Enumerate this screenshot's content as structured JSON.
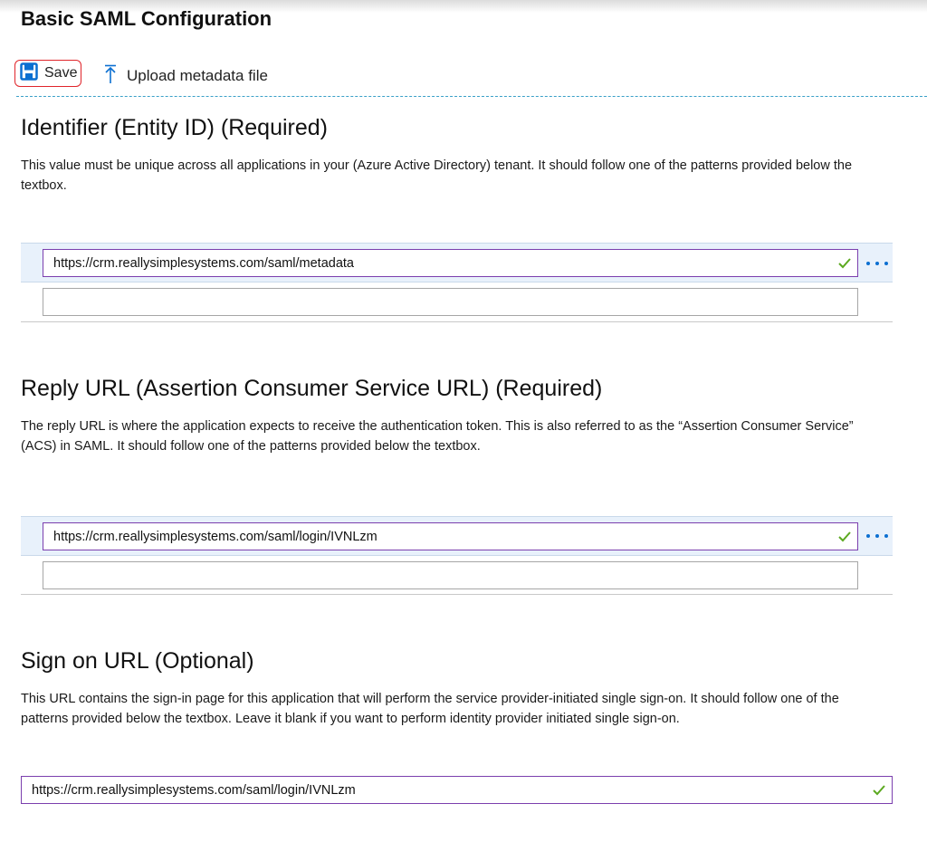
{
  "page": {
    "title": "Basic SAML Configuration"
  },
  "toolbar": {
    "save_label": "Save",
    "upload_label": "Upload metadata file"
  },
  "sections": [
    {
      "heading": "Identifier (Entity ID) (Required)",
      "description": "This value must be unique across all applications in your (Azure Active Directory) tenant. It should follow one of the patterns provided below the textbox.",
      "values": [
        "https://crm.reallysimplesystems.com/saml/metadata",
        ""
      ]
    },
    {
      "heading": "Reply URL (Assertion Consumer Service URL) (Required)",
      "description": "The reply URL is where the application expects to receive the authentication token. This is also referred to as the “Assertion Consumer Service” (ACS) in SAML. It should follow one of the patterns provided below the textbox.",
      "values": [
        "https://crm.reallysimplesystems.com/saml/login/IVNLzm",
        ""
      ]
    },
    {
      "heading": "Sign on URL (Optional)",
      "description": "This URL contains the sign-in page for this application that will perform the service provider-initiated single sign-on. It should follow one of the patterns provided below the textbox. Leave it blank if you want to perform identity provider initiated single sign-on.",
      "value": "https://crm.reallysimplesystems.com/saml/login/IVNLzm"
    }
  ],
  "icons": {
    "save": "floppy-disk-icon",
    "upload": "upload-arrow-icon",
    "valid": "checkmark-icon",
    "more": "more-options-icon"
  },
  "colors": {
    "accent": "#0b6fd1",
    "save_highlight": "#e0252b",
    "field_border": "#7b3fae",
    "check": "#5ca920"
  }
}
